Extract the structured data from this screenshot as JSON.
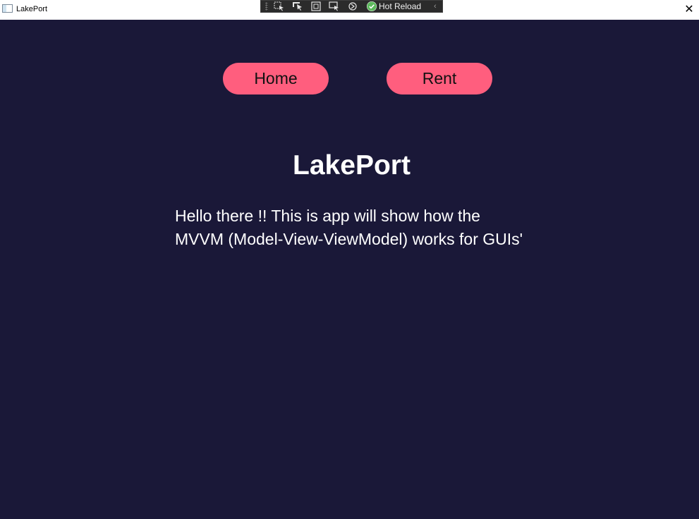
{
  "window": {
    "title": "LakePort",
    "close_glyph": "✕"
  },
  "debug_toolbar": {
    "hot_reload_label": "Hot Reload",
    "icons": [
      "select-element-icon",
      "track-focus-icon",
      "display-layout-adorners-icon",
      "binding-failures-icon",
      "hot-reload-status-icon"
    ],
    "collapse_glyph": "‹"
  },
  "nav": {
    "home_label": "Home",
    "rent_label": "Rent"
  },
  "main": {
    "title": "LakePort",
    "description": "Hello there !! This is app will show how the MVVM (Model-View-ViewModel) works for GUIs'"
  },
  "colors": {
    "background": "#1a1838",
    "accent": "#ff5e7e",
    "text": "#ffffff"
  }
}
